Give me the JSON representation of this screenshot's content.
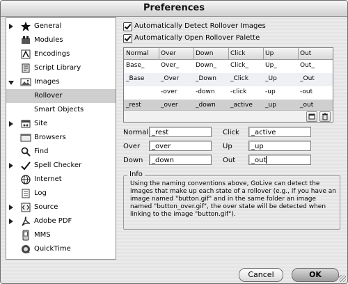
{
  "window": {
    "title": "Preferences"
  },
  "sidebar": {
    "items": [
      {
        "label": "General",
        "icon": "star-icon",
        "expand": "collapsed",
        "selected": false
      },
      {
        "label": "Modules",
        "icon": "modules-icon",
        "expand": "none",
        "selected": false
      },
      {
        "label": "Encodings",
        "icon": "encodings-icon",
        "expand": "none",
        "selected": false
      },
      {
        "label": "Script Library",
        "icon": "script-library-icon",
        "expand": "none",
        "selected": false
      },
      {
        "label": "Images",
        "icon": "images-icon",
        "expand": "expanded",
        "selected": false
      },
      {
        "label": "Rollover",
        "icon": "",
        "expand": "none",
        "selected": true
      },
      {
        "label": "Smart Objects",
        "icon": "",
        "expand": "none",
        "selected": false
      },
      {
        "label": "Site",
        "icon": "site-icon",
        "expand": "collapsed",
        "selected": false
      },
      {
        "label": "Browsers",
        "icon": "browsers-icon",
        "expand": "none",
        "selected": false
      },
      {
        "label": "Find",
        "icon": "find-icon",
        "expand": "none",
        "selected": false
      },
      {
        "label": "Spell Checker",
        "icon": "spell-checker-icon",
        "expand": "collapsed",
        "selected": false
      },
      {
        "label": "Internet",
        "icon": "internet-icon",
        "expand": "none",
        "selected": false
      },
      {
        "label": "Log",
        "icon": "log-icon",
        "expand": "none",
        "selected": false
      },
      {
        "label": "Source",
        "icon": "source-icon",
        "expand": "collapsed",
        "selected": false
      },
      {
        "label": "Adobe PDF",
        "icon": "adobe-pdf-icon",
        "expand": "collapsed",
        "selected": false
      },
      {
        "label": "MMS",
        "icon": "mms-icon",
        "expand": "none",
        "selected": false
      },
      {
        "label": "QuickTime",
        "icon": "quicktime-icon",
        "expand": "none",
        "selected": false
      }
    ]
  },
  "options": {
    "auto_detect": {
      "label": "Automatically Detect Rollover Images",
      "checked": true
    },
    "auto_open": {
      "label": "Automatically Open Rollover Palette",
      "checked": true
    }
  },
  "table": {
    "headers": [
      "Normal",
      "Over",
      "Down",
      "Click",
      "Up",
      "Out"
    ],
    "rows": [
      [
        "Base_",
        "Over_",
        "Down_",
        "Click_",
        "Up_",
        "Out_"
      ],
      [
        "_Base",
        "_Over",
        "_Down",
        "_Click",
        "_Up",
        "_Out"
      ],
      [
        "",
        "-over",
        "-down",
        "-click",
        "-up",
        "-out"
      ],
      [
        "_rest",
        "_over",
        "_down",
        "_active",
        "_up",
        "_out"
      ]
    ],
    "selected_row": 3,
    "footer_icons": [
      "new-item-icon",
      "trash-icon"
    ]
  },
  "fields": {
    "normal": {
      "label": "Normal",
      "value": "_rest"
    },
    "over": {
      "label": "Over",
      "value": "_over"
    },
    "down": {
      "label": "Down",
      "value": "_down"
    },
    "click": {
      "label": "Click",
      "value": "_active"
    },
    "up": {
      "label": "Up",
      "value": "_up"
    },
    "out": {
      "label": "Out",
      "value": "_out"
    }
  },
  "info": {
    "title": "Info",
    "text": "Using the naming conventions above, GoLive can detect the images that make up each state of a rollover (e.g., if you have an image named \"button.gif\" and in the same folder an image named \"button_over.gif\", the over state will be detected when linking to the image \"button.gif\")."
  },
  "buttons": {
    "cancel": "Cancel",
    "ok": "OK"
  },
  "colors": {
    "selection": "#cfcfcf",
    "window_bg": "#e8e8e8"
  }
}
